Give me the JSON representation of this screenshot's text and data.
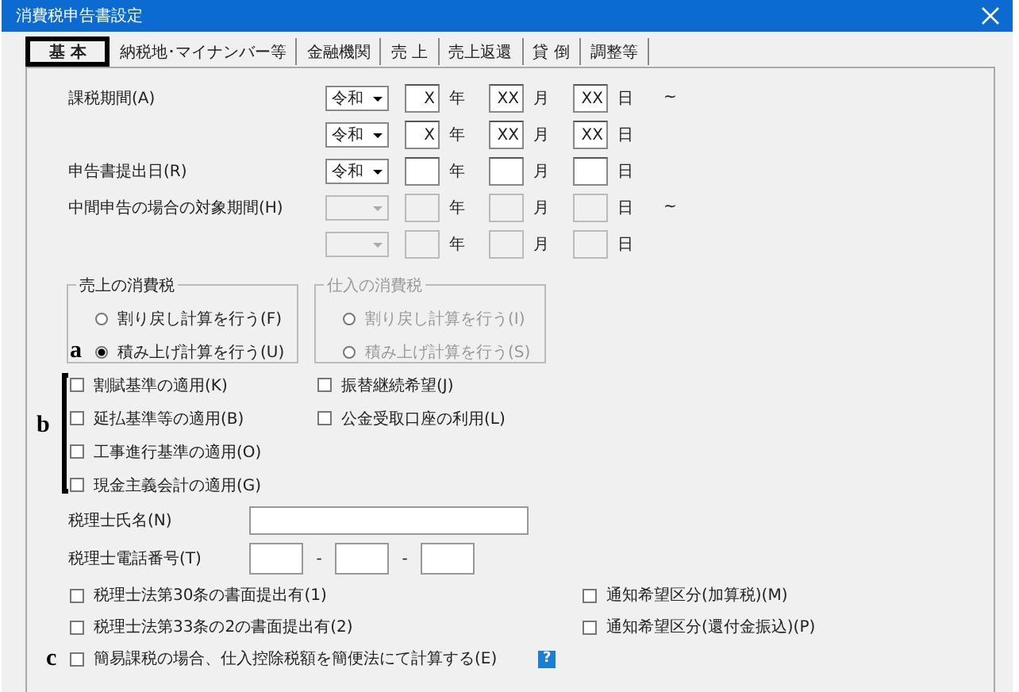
{
  "window": {
    "title": "消費税申告書設定"
  },
  "tabs": [
    {
      "label": "基 本",
      "selected": true
    },
    {
      "label": "納税地･マイナンバー等",
      "selected": false
    },
    {
      "label": "金融機関",
      "selected": false
    },
    {
      "label": "売 上",
      "selected": false
    },
    {
      "label": "売上返還",
      "selected": false
    },
    {
      "label": "貸 倒",
      "selected": false
    },
    {
      "label": "調整等",
      "selected": false
    }
  ],
  "date_rows": [
    {
      "label": "課税期間(A)",
      "era": "令和",
      "year": "X",
      "month": "XX",
      "day": "XX",
      "units": [
        "年",
        "月",
        "日"
      ],
      "disabled": false,
      "tilde": "~"
    },
    {
      "era": "令和",
      "year": "X",
      "month": "XX",
      "day": "XX",
      "units": [
        "年",
        "月",
        "日"
      ],
      "disabled": false
    },
    {
      "label": "申告書提出日(R)",
      "era": "令和",
      "units": [
        "年",
        "月",
        "日"
      ],
      "disabled": false
    },
    {
      "label": "中間申告の場合の対象期間(H)",
      "units": [
        "年",
        "月",
        "日"
      ],
      "disabled": true,
      "tilde": "~"
    },
    {
      "units": [
        "年",
        "月",
        "日"
      ],
      "disabled": true
    }
  ],
  "groups": [
    {
      "title": "売上の消費税",
      "disabled": false,
      "marker": "a",
      "options": [
        {
          "label": "割り戻し計算を行う(F)",
          "selected": false
        },
        {
          "label": "積み上げ計算を行う(U)",
          "selected": true
        }
      ]
    },
    {
      "title": "仕入の消費税",
      "disabled": true,
      "options": [
        {
          "label": "割り戻し計算を行う(I)",
          "selected": false
        },
        {
          "label": "積み上げ計算を行う(S)",
          "selected": false
        }
      ]
    }
  ],
  "bracket_marker": "b",
  "checks_left": [
    {
      "label": "割賦基準の適用(K)",
      "checked": false
    },
    {
      "label": "延払基準等の適用(B)",
      "checked": false
    },
    {
      "label": "工事進行基準の適用(O)",
      "checked": false
    },
    {
      "label": "現金主義会計の適用(G)",
      "checked": false
    }
  ],
  "checks_right": [
    {
      "label": "振替継続希望(J)",
      "checked": false
    },
    {
      "label": "公金受取口座の利用(L)",
      "checked": false
    }
  ],
  "accountant_name": {
    "label": "税理士氏名(N)"
  },
  "accountant_phone": {
    "label": "税理士電話番号(T)",
    "separators": [
      "-",
      "-"
    ]
  },
  "bottom_checks": [
    {
      "label": "税理士法第30条の書面提出有(1)",
      "checked": false
    },
    {
      "label": "通知希望区分(加算税)(M)",
      "checked": false
    },
    {
      "label": "税理士法第33条の2の書面提出有(2)",
      "checked": false
    },
    {
      "label": "通知希望区分(還付金振込)(P)",
      "checked": false
    }
  ],
  "simplified_check": {
    "marker": "c",
    "label": "簡易課税の場合、仕入控除税額を簡便法にて計算する(E)",
    "checked": false,
    "help": "?"
  }
}
